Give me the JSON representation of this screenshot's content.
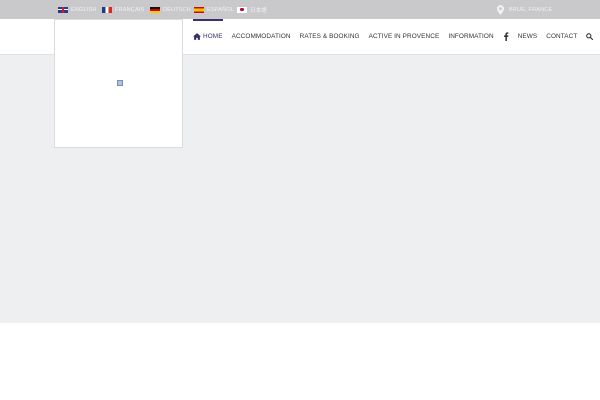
{
  "topbar": {
    "languages": [
      {
        "code": "en",
        "label": "English"
      },
      {
        "code": "fr",
        "label": "Français"
      },
      {
        "code": "de",
        "label": "Deutsch"
      },
      {
        "code": "es",
        "label": "Español"
      },
      {
        "code": "ja",
        "label": "日本語"
      }
    ],
    "location": {
      "label": "Brue, France",
      "icon": "map-pin-icon"
    }
  },
  "header": {
    "nav": [
      {
        "label": "Home",
        "active": true,
        "icon": "home-icon"
      },
      {
        "label": "Accommodation"
      },
      {
        "label": "Rates & Booking"
      },
      {
        "label": "Active in Provence"
      },
      {
        "label": "Information"
      },
      {
        "label": "",
        "icon": "facebook-icon"
      },
      {
        "label": "News"
      },
      {
        "label": "Contact"
      },
      {
        "label": "",
        "icon": "search-icon"
      }
    ]
  },
  "colors": {
    "topbar_bg": "#c9c9cc",
    "accent": "#3e2f6a",
    "hero_bg": "#eeeff1"
  }
}
